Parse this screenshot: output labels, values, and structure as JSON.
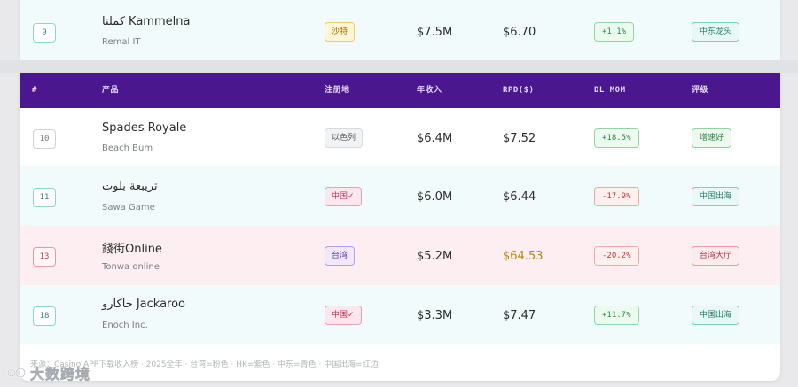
{
  "table": {
    "headers": {
      "rank": "#",
      "product": "产品",
      "region": "注册地",
      "revenue": "年收入",
      "rpd": "RPD($)",
      "dl_mom": "DL MOM",
      "grade": "评级"
    },
    "top_row": {
      "rank": "9",
      "name": "كملنا Kammelna",
      "developer": "Remal IT",
      "region": "沙特",
      "revenue": "$7.5M",
      "rpd": "$6.70",
      "dl_mom": "+1.1%",
      "grade": "中东龙头"
    },
    "rows": [
      {
        "rank": "10",
        "name": "Spades Royale",
        "developer": "Beach Bum",
        "region": "以色列",
        "revenue": "$6.4M",
        "rpd": "$7.52",
        "dl_mom": "+18.5%",
        "grade": "增速好"
      },
      {
        "rank": "11",
        "name": "تريبعة بلوت",
        "developer": "Sawa Game",
        "region": "中国✓",
        "revenue": "$6.0M",
        "rpd": "$6.44",
        "dl_mom": "-17.9%",
        "grade": "中国出海"
      },
      {
        "rank": "13",
        "name": "錢街Online",
        "developer": "Tonwa online",
        "region": "台湾",
        "revenue": "$5.2M",
        "rpd": "$64.53",
        "dl_mom": "-20.2%",
        "grade": "台湾大厅"
      },
      {
        "rank": "18",
        "name": "جاكارو Jackaroo",
        "developer": "Enoch Inc.",
        "region": "中国✓",
        "revenue": "$3.3M",
        "rpd": "$7.47",
        "dl_mom": "+11.7%",
        "grade": "中国出海"
      }
    ]
  },
  "footnote": "来源：Casino APP下载收入榜 · 2025全年 · 台湾=粉色 · HK=紫色 · 中东=青色 · 中国出海=红边",
  "watermark": {
    "text": "大数跨境"
  },
  "colors": {
    "header_bg": "#4b178f",
    "row_cyan": "#f2fbfb",
    "row_pink": "#fdeef1",
    "gold_value": "#b8860b"
  }
}
